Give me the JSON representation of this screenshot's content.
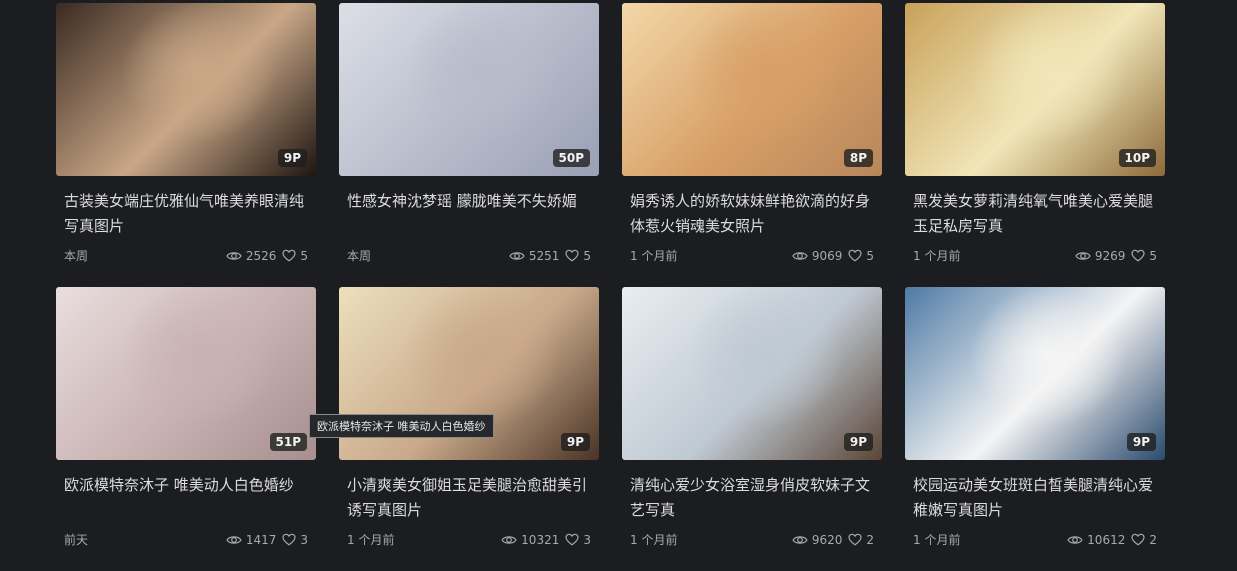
{
  "cards": [
    {
      "count": "9P",
      "title": "古装美女端庄优雅仙气唯美养眼清纯写真图片",
      "date": "本周",
      "views": "2526",
      "likes": "5",
      "thumb": {
        "c1": "#3a2a22",
        "c2": "#c9a786",
        "c3": "#1e1512"
      }
    },
    {
      "count": "50P",
      "title": "性感女神沈梦瑶 朦胧唯美不失娇媚",
      "date": "本周",
      "views": "5251",
      "likes": "5",
      "thumb": {
        "c1": "#dcdfe6",
        "c2": "#b7bccb",
        "c3": "#9aa0b5"
      }
    },
    {
      "count": "8P",
      "title": "娟秀诱人的娇软妹妹鲜艳欲滴的好身体惹火销魂美女照片",
      "date": "1 个月前",
      "views": "9069",
      "likes": "5",
      "thumb": {
        "c1": "#f3d8a8",
        "c2": "#d8a068",
        "c3": "#b7865a"
      }
    },
    {
      "count": "10P",
      "title": "黑发美女萝莉清纯氧气唯美心爱美腿玉足私房写真",
      "date": "1 个月前",
      "views": "9269",
      "likes": "5",
      "thumb": {
        "c1": "#c9a15a",
        "c2": "#f1e6b8",
        "c3": "#8d6a3a"
      }
    },
    {
      "count": "51P",
      "title": "欧派模特奈沐子 唯美动人白色婚纱",
      "date": "前天",
      "views": "1417",
      "likes": "3",
      "thumb": {
        "c1": "#e9dede",
        "c2": "#c9b2b2",
        "c3": "#a78f8f"
      }
    },
    {
      "count": "9P",
      "title": "小清爽美女御姐玉足美腿治愈甜美引诱写真图片",
      "date": "1 个月前",
      "views": "10321",
      "likes": "3",
      "thumb": {
        "c1": "#ece0bd",
        "c2": "#c9a98a",
        "c3": "#4a3426"
      }
    },
    {
      "count": "9P",
      "title": "清纯心爱少女浴室湿身俏皮软妹子文艺写真",
      "date": "1 个月前",
      "views": "9620",
      "likes": "2",
      "thumb": {
        "c1": "#e8edf1",
        "c2": "#bfc9d2",
        "c3": "#5b4537"
      }
    },
    {
      "count": "9P",
      "title": "校园运动美女班斑白皙美腿清纯心爱稚嫩写真图片",
      "date": "1 个月前",
      "views": "10612",
      "likes": "2",
      "thumb": {
        "c1": "#4e7aa5",
        "c2": "#f4f4f4",
        "c3": "#2a4a6e"
      }
    }
  ],
  "tooltip": "欧派模特奈沐子 唯美动人白色婚纱",
  "icons": {
    "views": "eye-icon",
    "likes": "heart-icon"
  }
}
